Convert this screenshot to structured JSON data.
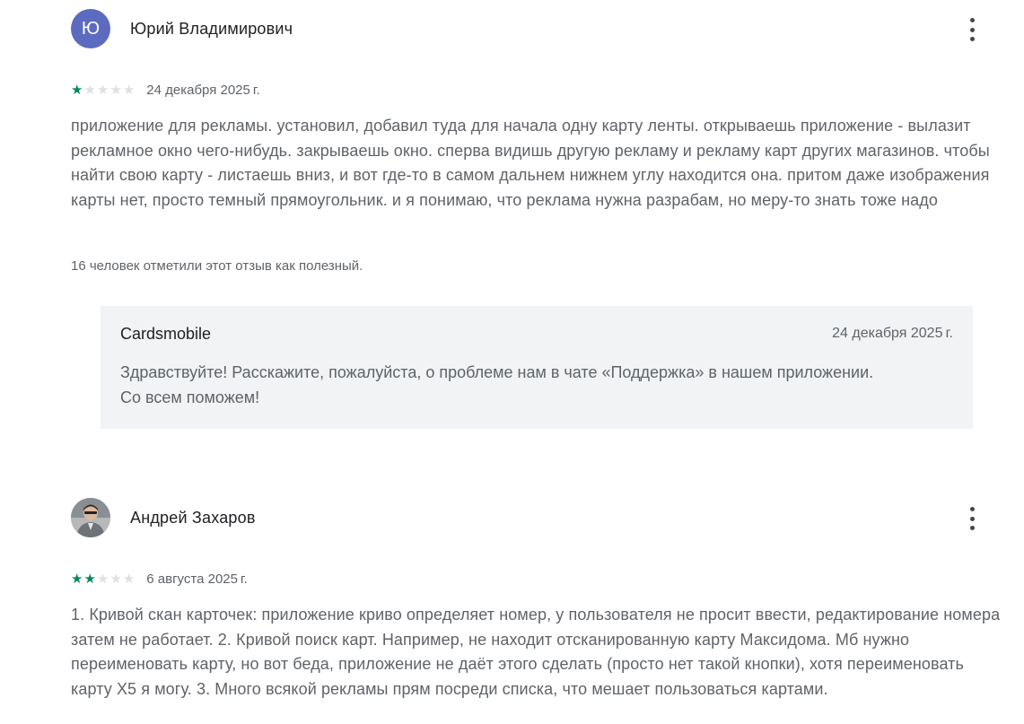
{
  "reviews": [
    {
      "avatar_letter": "Ю",
      "author": "Юрий Владимирович",
      "rating": 1,
      "date": "24 декабря 2025 г.",
      "text": "приложение для рекламы. установил, добавил туда для начала одну карту ленты. открываешь приложение - вылазит рекламное окно чего-нибудь. закрываешь окно. сперва видишь другую рекламу и рекламу карт других магазинов. чтобы найти свою карту - листаешь вниз, и вот где-то в самом дальнем нижнем углу находится она. притом даже изображения карты нет, просто темный прямоугольник. и я понимаю, что реклама нужна разрабам, но меру-то знать тоже надо",
      "helpful": "16 человек отметили этот отзыв как полезный.",
      "reply": {
        "author": "Cardsmobile",
        "date": "24 декабря 2025 г.",
        "text": "Здравствуйте! Расскажите, пожалуйста, о проблеме нам в чате «Поддержка» в нашем приложении. Со всем поможем!"
      }
    },
    {
      "author": "Андрей Захаров",
      "rating": 2,
      "date": "6 августа 2025 г.",
      "text": "1. Кривой скан карточек: приложение криво определяет номер, у пользователя не просит ввести, редактирование номера затем не работает. 2. Кривой поиск карт. Например, не находит отсканированную карту Максидома. Мб нужно переименовать карту, но вот беда, приложение не даёт этого сделать (просто нет такой кнопки), хотя переименовать карту Х5 я могу. 3. Много всякой рекламы прям посреди списка, что мешает пользоваться картами."
    }
  ],
  "colors": {
    "star_filled": "#01875f",
    "star_empty": "#e0e0e0",
    "avatar_letter_bg": "#5c6bc0",
    "reply_bg": "#f1f3f4"
  },
  "icons": {
    "more": "more-vert-icon",
    "star": "star-icon"
  }
}
